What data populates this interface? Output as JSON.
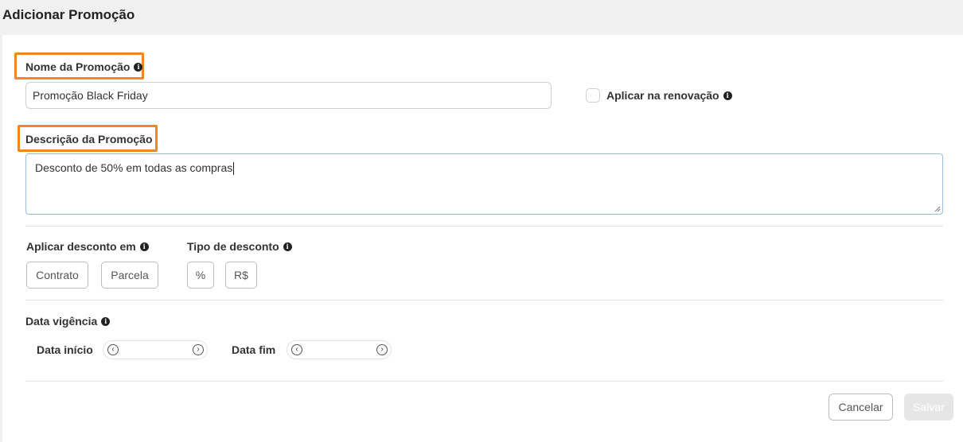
{
  "header": {
    "title": "Adicionar Promoção"
  },
  "form": {
    "name": {
      "label": "Nome da Promoção",
      "value": "Promoção Black Friday"
    },
    "renewal": {
      "label": "Aplicar na renovação",
      "checked": false
    },
    "description": {
      "label": "Descrição da Promoção",
      "value": "Desconto de 50% em todas as compras"
    },
    "apply_discount": {
      "label": "Aplicar desconto em",
      "options": [
        "Contrato",
        "Parcela"
      ]
    },
    "discount_type": {
      "label": "Tipo de desconto",
      "options": [
        "%",
        "R$"
      ]
    },
    "validity": {
      "label": "Data vigência",
      "start_label": "Data início",
      "end_label": "Data fim",
      "start_value": "",
      "end_value": ""
    }
  },
  "footer": {
    "cancel_label": "Cancelar",
    "save_label": "Salvar"
  },
  "colors": {
    "highlight": "#f4861f",
    "textarea_border": "#9bbbe0",
    "save_disabled": "#e6e6e6"
  }
}
